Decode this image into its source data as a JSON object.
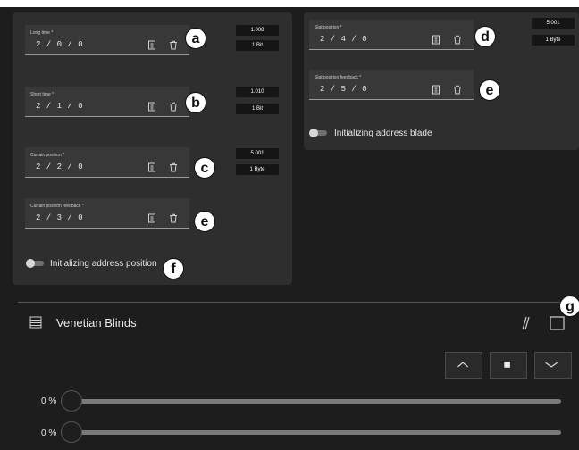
{
  "left_card": {
    "fields": [
      {
        "label": "Long time *",
        "value": "2 / 0 /  0",
        "address": "1.008",
        "type": "1 Bit",
        "badge": "a"
      },
      {
        "label": "Short time *",
        "value": "2 / 1 /  0",
        "address": "1.010",
        "type": "1 Bit",
        "badge": "b"
      },
      {
        "label": "Curtain position *",
        "value": "2 / 2 /  0",
        "address": "5.001",
        "type": "1 Byte",
        "badge": "c"
      },
      {
        "label": "Curtain position feedback *",
        "value": "2 / 3 /  0",
        "badge": "e"
      }
    ],
    "toggle_label": "Initializing address position",
    "toggle_badge": "f"
  },
  "right_card": {
    "fields": [
      {
        "label": "Slat position *",
        "value": "2 / 4 /  0",
        "badge": "d"
      },
      {
        "label": "Slat position feedback *",
        "value": "2 / 5 /  0",
        "badge": "e"
      }
    ],
    "address": "5.001",
    "type": "1 Byte",
    "toggle_label": "Initializing address blade"
  },
  "widget": {
    "title": "Venetian Blinds",
    "badge": "g",
    "buttons": [
      "up-chevron-icon",
      "stop-icon",
      "down-chevron-icon"
    ],
    "slider1_value": "0 %",
    "slider2_value": "0 %"
  },
  "colors": {
    "background": "#1d1d1d",
    "card": "#2e2e2e",
    "field": "#383838",
    "address_box": "#151515"
  }
}
